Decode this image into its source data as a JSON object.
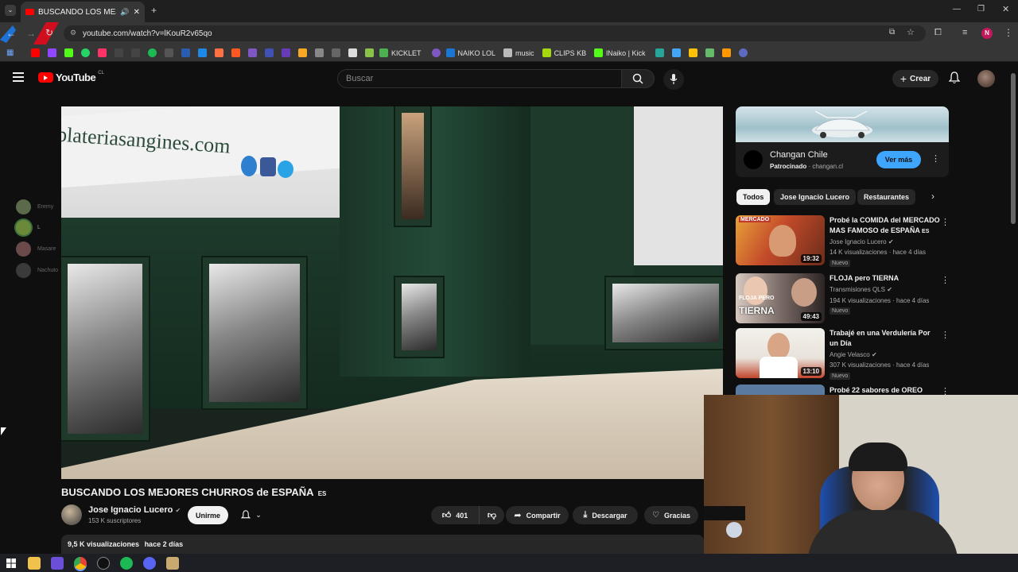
{
  "browser": {
    "tab_title": "BUSCANDO LOS MEJORES",
    "new_tab": "+",
    "url": "youtube.com/watch?v=lKouR2v65qo",
    "profile_initial": "N",
    "bookmarks": [
      "KICKLET",
      "NAIKO LOL",
      "music",
      "CLIPS KB",
      "lNaiko | Kick"
    ]
  },
  "header": {
    "logo_text": "YouTube",
    "region": "CL",
    "search_placeholder": "Buscar",
    "create_label": "Crear"
  },
  "discord_overlay": {
    "users": [
      "Eremy",
      "L",
      "Masare",
      "Nachuto"
    ]
  },
  "video": {
    "title": "BUSCANDO LOS MEJORES CHURROS de ESPAÑA",
    "title_flag": "ES",
    "wall_text": "plateriasangines.com"
  },
  "channel": {
    "name": "Jose Ignacio Lucero",
    "subscribers": "153 K suscriptores",
    "join_label": "Unirme"
  },
  "actions": {
    "likes": "401",
    "share_label": "Compartir",
    "download_label": "Descargar",
    "thanks_label": "Gracias"
  },
  "description": {
    "views": "9,5 K visualizaciones",
    "date": "hace 2 días"
  },
  "ad": {
    "brand": "Changan Chile",
    "sponsored": "Patrocinado",
    "domain": "changan.cl",
    "cta": "Ver más"
  },
  "chips": [
    "Todos",
    "Jose Ignacio Lucero",
    "Restaurantes"
  ],
  "recommendations": [
    {
      "title": "Probé la COMIDA del MERCADO MAS FAMOSO de ESPAÑA",
      "flag": "ES",
      "thumb_text": "MERCADO",
      "channel": "Jose Ignacio Lucero",
      "verified": true,
      "meta": "14 K visualizaciones · hace 4 días",
      "badge": "Nuevo",
      "duration": "19:32"
    },
    {
      "title": "FLOJA pero TIERNA",
      "thumb_text_1": "FLOJA PERO",
      "thumb_text_2": "TIERNA",
      "channel": "Transmisiones QLS",
      "verified": true,
      "meta": "194 K visualizaciones · hace 4 días",
      "badge": "Nuevo",
      "duration": "49:43"
    },
    {
      "title": "Trabajé en una Verdulería Por un Día",
      "channel": "Angie Velasco",
      "verified": true,
      "meta": "307 K visualizaciones · hace 4 días",
      "badge": "Nuevo",
      "duration": "13:10"
    },
    {
      "title": "Probé 22 sabores de OREO"
    }
  ],
  "colors": {
    "bg": "#0f0f0f",
    "accent_blue": "#3ea6ff",
    "yt_red": "#ff0000"
  }
}
